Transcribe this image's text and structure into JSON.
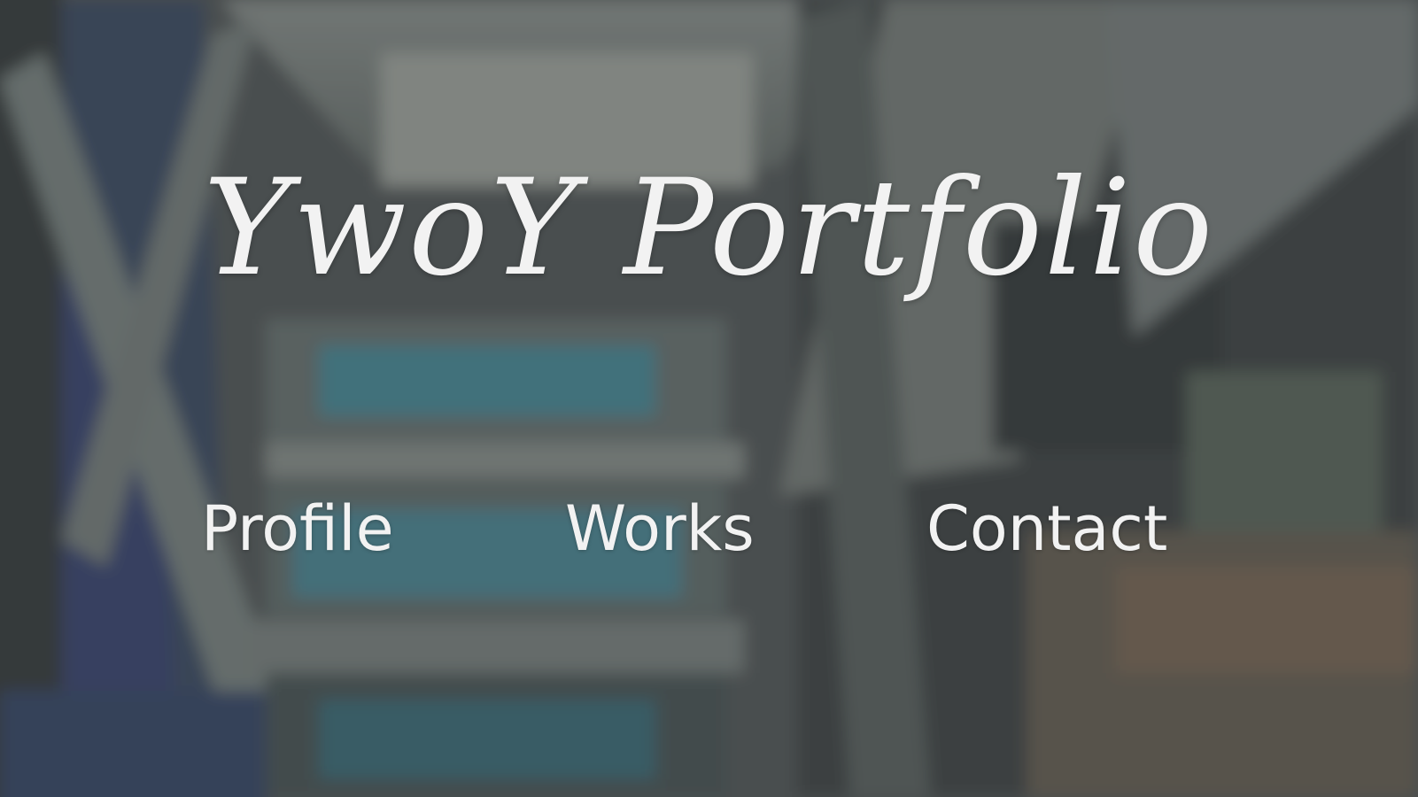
{
  "site": {
    "title": "YwoY Portfolio"
  },
  "nav": {
    "items": [
      {
        "label": "Profile"
      },
      {
        "label": "Works"
      },
      {
        "label": "Contact"
      }
    ]
  },
  "colors": {
    "text": "#f2f2f2",
    "overlay": "#2c3032"
  }
}
